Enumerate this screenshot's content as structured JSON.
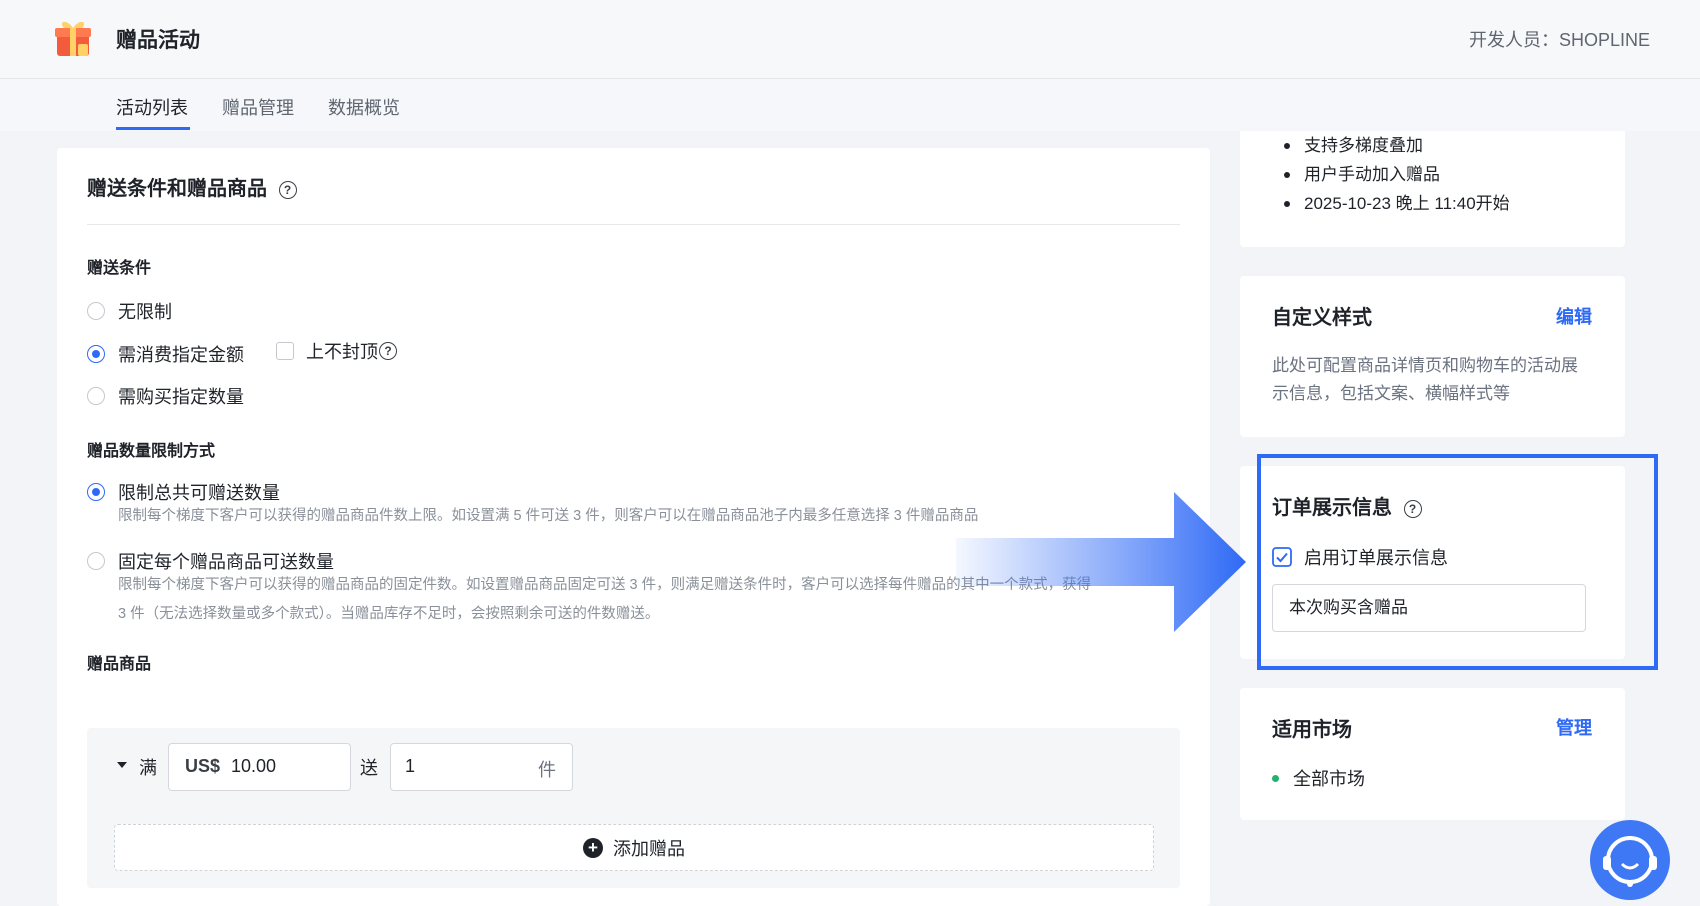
{
  "header": {
    "app_title": "赠品活动",
    "developer": "开发人员：SHOPLINE"
  },
  "tabs": [
    {
      "label": "活动列表",
      "active": true
    },
    {
      "label": "赠品管理",
      "active": false
    },
    {
      "label": "数据概览",
      "active": false
    }
  ],
  "main": {
    "section_title": "赠送条件和赠品商品",
    "condition_label": "赠送条件",
    "conditions": [
      {
        "label": "无限制",
        "checked": false
      },
      {
        "label": "需消费指定金额",
        "checked": true
      },
      {
        "label": "需购买指定数量",
        "checked": false
      }
    ],
    "no_cap_label": "上不封顶",
    "limit_label": "赠品数量限制方式",
    "limit_options": [
      {
        "label": "限制总共可赠送数量",
        "checked": true,
        "desc": "限制每个梯度下客户可以获得的赠品商品件数上限。如设置满 5 件可送 3 件，则客户可以在赠品商品池子内最多任意选择 3 件赠品商品"
      },
      {
        "label": "固定每个赠品商品可送数量",
        "checked": false,
        "desc": "限制每个梯度下客户可以获得的赠品商品的固定件数。如设置赠品商品固定可送 3 件，则满足赠送条件时，客户可以选择每件赠品的其中一个款式，获得",
        "desc2": "3 件（无法选择数量或多个款式）。当赠品库存不足时，会按照剩余可送的件数赠送。"
      }
    ],
    "gift_products_label": "赠品商品",
    "tier": {
      "full_label": "满",
      "currency": "US$",
      "amount": "10.00",
      "give_label": "送",
      "quantity": "1",
      "unit": "件"
    },
    "add_gift_label": "添加赠品"
  },
  "right": {
    "summary_items": [
      "支持多梯度叠加",
      "用户手动加入赠品",
      "2025-10-23 晚上 11:40开始"
    ],
    "custom_style": {
      "title": "自定义样式",
      "edit_label": "编辑",
      "desc": "此处可配置商品详情页和购物车的活动展示信息，包括文案、横幅样式等"
    },
    "order_display": {
      "title": "订单展示信息",
      "checkbox_label": "启用订单展示信息",
      "checked": true,
      "input_value": "本次购买含赠品"
    },
    "market": {
      "title": "适用市场",
      "manage_label": "管理",
      "item": "全部市场"
    }
  },
  "colors": {
    "accent": "#2f6af6",
    "market_dot": "#23b26d"
  },
  "icons": [
    "gift-logo-icon",
    "help-icon",
    "plus-circle-icon",
    "caret-down-icon",
    "checkmark-icon",
    "arrow-right-icon",
    "customer-support-icon"
  ]
}
